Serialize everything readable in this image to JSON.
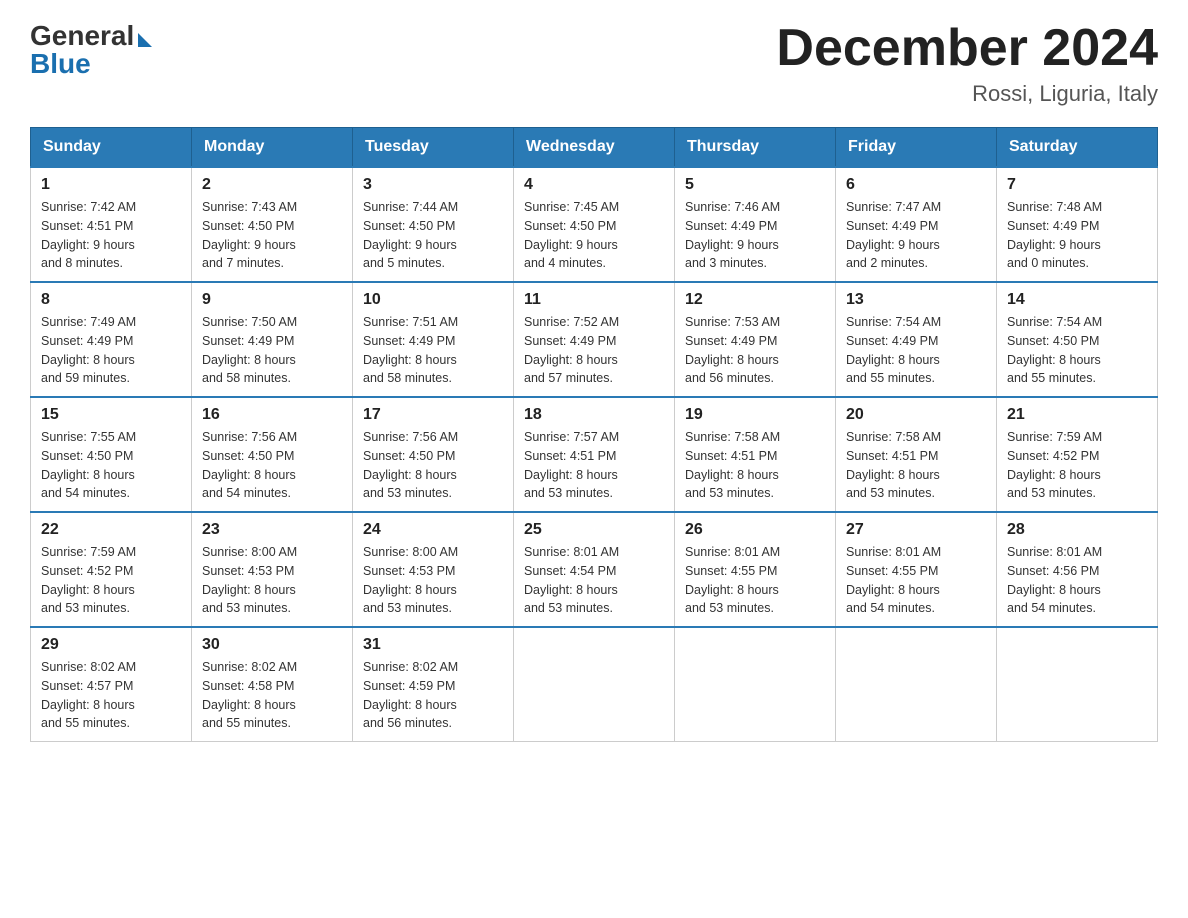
{
  "logo": {
    "general": "General",
    "blue": "Blue"
  },
  "title": "December 2024",
  "subtitle": "Rossi, Liguria, Italy",
  "days_of_week": [
    "Sunday",
    "Monday",
    "Tuesday",
    "Wednesday",
    "Thursday",
    "Friday",
    "Saturday"
  ],
  "weeks": [
    [
      {
        "day": "1",
        "sunrise": "7:42 AM",
        "sunset": "4:51 PM",
        "daylight": "9 hours and 8 minutes."
      },
      {
        "day": "2",
        "sunrise": "7:43 AM",
        "sunset": "4:50 PM",
        "daylight": "9 hours and 7 minutes."
      },
      {
        "day": "3",
        "sunrise": "7:44 AM",
        "sunset": "4:50 PM",
        "daylight": "9 hours and 5 minutes."
      },
      {
        "day": "4",
        "sunrise": "7:45 AM",
        "sunset": "4:50 PM",
        "daylight": "9 hours and 4 minutes."
      },
      {
        "day": "5",
        "sunrise": "7:46 AM",
        "sunset": "4:49 PM",
        "daylight": "9 hours and 3 minutes."
      },
      {
        "day": "6",
        "sunrise": "7:47 AM",
        "sunset": "4:49 PM",
        "daylight": "9 hours and 2 minutes."
      },
      {
        "day": "7",
        "sunrise": "7:48 AM",
        "sunset": "4:49 PM",
        "daylight": "9 hours and 0 minutes."
      }
    ],
    [
      {
        "day": "8",
        "sunrise": "7:49 AM",
        "sunset": "4:49 PM",
        "daylight": "8 hours and 59 minutes."
      },
      {
        "day": "9",
        "sunrise": "7:50 AM",
        "sunset": "4:49 PM",
        "daylight": "8 hours and 58 minutes."
      },
      {
        "day": "10",
        "sunrise": "7:51 AM",
        "sunset": "4:49 PM",
        "daylight": "8 hours and 58 minutes."
      },
      {
        "day": "11",
        "sunrise": "7:52 AM",
        "sunset": "4:49 PM",
        "daylight": "8 hours and 57 minutes."
      },
      {
        "day": "12",
        "sunrise": "7:53 AM",
        "sunset": "4:49 PM",
        "daylight": "8 hours and 56 minutes."
      },
      {
        "day": "13",
        "sunrise": "7:54 AM",
        "sunset": "4:49 PM",
        "daylight": "8 hours and 55 minutes."
      },
      {
        "day": "14",
        "sunrise": "7:54 AM",
        "sunset": "4:50 PM",
        "daylight": "8 hours and 55 minutes."
      }
    ],
    [
      {
        "day": "15",
        "sunrise": "7:55 AM",
        "sunset": "4:50 PM",
        "daylight": "8 hours and 54 minutes."
      },
      {
        "day": "16",
        "sunrise": "7:56 AM",
        "sunset": "4:50 PM",
        "daylight": "8 hours and 54 minutes."
      },
      {
        "day": "17",
        "sunrise": "7:56 AM",
        "sunset": "4:50 PM",
        "daylight": "8 hours and 53 minutes."
      },
      {
        "day": "18",
        "sunrise": "7:57 AM",
        "sunset": "4:51 PM",
        "daylight": "8 hours and 53 minutes."
      },
      {
        "day": "19",
        "sunrise": "7:58 AM",
        "sunset": "4:51 PM",
        "daylight": "8 hours and 53 minutes."
      },
      {
        "day": "20",
        "sunrise": "7:58 AM",
        "sunset": "4:51 PM",
        "daylight": "8 hours and 53 minutes."
      },
      {
        "day": "21",
        "sunrise": "7:59 AM",
        "sunset": "4:52 PM",
        "daylight": "8 hours and 53 minutes."
      }
    ],
    [
      {
        "day": "22",
        "sunrise": "7:59 AM",
        "sunset": "4:52 PM",
        "daylight": "8 hours and 53 minutes."
      },
      {
        "day": "23",
        "sunrise": "8:00 AM",
        "sunset": "4:53 PM",
        "daylight": "8 hours and 53 minutes."
      },
      {
        "day": "24",
        "sunrise": "8:00 AM",
        "sunset": "4:53 PM",
        "daylight": "8 hours and 53 minutes."
      },
      {
        "day": "25",
        "sunrise": "8:01 AM",
        "sunset": "4:54 PM",
        "daylight": "8 hours and 53 minutes."
      },
      {
        "day": "26",
        "sunrise": "8:01 AM",
        "sunset": "4:55 PM",
        "daylight": "8 hours and 53 minutes."
      },
      {
        "day": "27",
        "sunrise": "8:01 AM",
        "sunset": "4:55 PM",
        "daylight": "8 hours and 54 minutes."
      },
      {
        "day": "28",
        "sunrise": "8:01 AM",
        "sunset": "4:56 PM",
        "daylight": "8 hours and 54 minutes."
      }
    ],
    [
      {
        "day": "29",
        "sunrise": "8:02 AM",
        "sunset": "4:57 PM",
        "daylight": "8 hours and 55 minutes."
      },
      {
        "day": "30",
        "sunrise": "8:02 AM",
        "sunset": "4:58 PM",
        "daylight": "8 hours and 55 minutes."
      },
      {
        "day": "31",
        "sunrise": "8:02 AM",
        "sunset": "4:59 PM",
        "daylight": "8 hours and 56 minutes."
      },
      null,
      null,
      null,
      null
    ]
  ],
  "labels": {
    "sunrise": "Sunrise:",
    "sunset": "Sunset:",
    "daylight": "Daylight:"
  }
}
